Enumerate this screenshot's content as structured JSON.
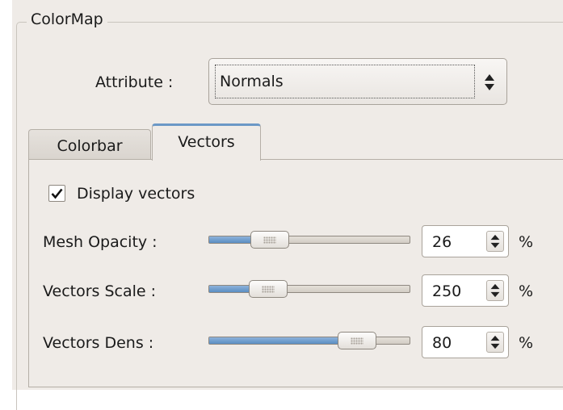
{
  "group": {
    "title": "ColorMap"
  },
  "attribute": {
    "label": "Attribute :",
    "value": "Normals"
  },
  "tabs": [
    {
      "label": "Colorbar",
      "selected": false
    },
    {
      "label": "Vectors",
      "selected": true
    }
  ],
  "vectors": {
    "display_label": "Display vectors",
    "display_checked": true,
    "rows": [
      {
        "label": "Mesh Opacity :",
        "value": "26",
        "unit": "%",
        "slider_fraction": 0.26
      },
      {
        "label": "Vectors Scale :",
        "value": "250",
        "unit": "%",
        "slider_fraction": 0.25
      },
      {
        "label": "Vectors Dens :",
        "value": "80",
        "unit": "%",
        "slider_fraction": 0.8
      }
    ]
  },
  "colors": {
    "panel_bg": "#efebe7",
    "accent_tab": "#6b98c6",
    "slider_fill": "#5a8ec2"
  }
}
